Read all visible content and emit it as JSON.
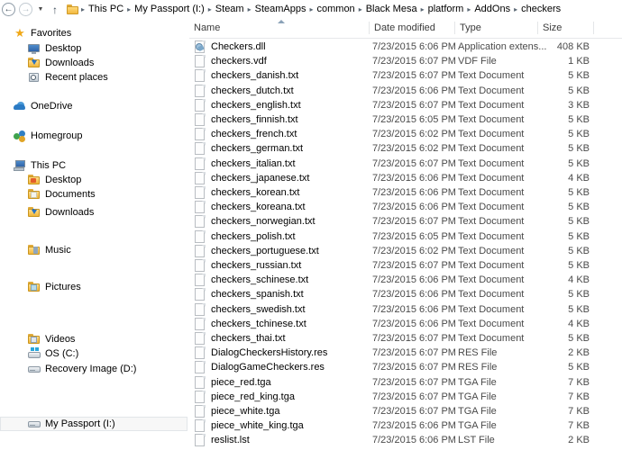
{
  "nav": {
    "back_label": "Back",
    "forward_label": "Forward",
    "recent_label": "Recent locations",
    "up_label": "Up one level",
    "breadcrumb": [
      "This PC",
      "My Passport (I:)",
      "Steam",
      "SteamApps",
      "common",
      "Black Mesa",
      "platform",
      "AddOns",
      "checkers"
    ],
    "separator": "▸"
  },
  "sidebar": {
    "groups": [
      {
        "name": "Favorites",
        "icon": "star-icon",
        "items": [
          {
            "label": "Desktop",
            "icon": "monitor-icon"
          },
          {
            "label": "Downloads",
            "icon": "downloads-folder-icon"
          },
          {
            "label": "Recent places",
            "icon": "recent-places-icon"
          }
        ]
      },
      {
        "name": "OneDrive",
        "icon": "cloud-icon",
        "items": []
      },
      {
        "name": "Homegroup",
        "icon": "homegroup-icon",
        "items": []
      },
      {
        "name": "This PC",
        "icon": "this-pc-icon",
        "items": [
          {
            "label": "Desktop",
            "icon": "desktop-folder-icon"
          },
          {
            "label": "Documents",
            "icon": "documents-folder-icon"
          },
          {
            "label": "Downloads",
            "icon": "downloads-folder-icon"
          },
          {
            "label": "Music",
            "icon": "music-folder-icon"
          },
          {
            "label": "Pictures",
            "icon": "pictures-folder-icon"
          },
          {
            "label": "Videos",
            "icon": "videos-folder-icon"
          },
          {
            "label": "OS (C:)",
            "icon": "os-drive-icon"
          },
          {
            "label": "Recovery Image (D:)",
            "icon": "drive-icon"
          }
        ]
      }
    ],
    "selected": {
      "label": "My Passport (I:)",
      "icon": "drive-icon"
    }
  },
  "columns": [
    {
      "key": "name",
      "label": "Name",
      "sorted": "asc"
    },
    {
      "key": "date",
      "label": "Date modified"
    },
    {
      "key": "type",
      "label": "Type"
    },
    {
      "key": "size",
      "label": "Size"
    }
  ],
  "files": [
    {
      "name": "Checkers.dll",
      "date": "7/23/2015 6:06 PM",
      "type": "Application extens...",
      "size": "408 KB",
      "icon": "dll-icon"
    },
    {
      "name": "checkers.vdf",
      "date": "7/23/2015 6:07 PM",
      "type": "VDF File",
      "size": "1 KB",
      "icon": "file-icon"
    },
    {
      "name": "checkers_danish.txt",
      "date": "7/23/2015 6:07 PM",
      "type": "Text Document",
      "size": "5 KB",
      "icon": "file-icon"
    },
    {
      "name": "checkers_dutch.txt",
      "date": "7/23/2015 6:06 PM",
      "type": "Text Document",
      "size": "5 KB",
      "icon": "file-icon"
    },
    {
      "name": "checkers_english.txt",
      "date": "7/23/2015 6:07 PM",
      "type": "Text Document",
      "size": "3 KB",
      "icon": "file-icon"
    },
    {
      "name": "checkers_finnish.txt",
      "date": "7/23/2015 6:05 PM",
      "type": "Text Document",
      "size": "5 KB",
      "icon": "file-icon"
    },
    {
      "name": "checkers_french.txt",
      "date": "7/23/2015 6:02 PM",
      "type": "Text Document",
      "size": "5 KB",
      "icon": "file-icon"
    },
    {
      "name": "checkers_german.txt",
      "date": "7/23/2015 6:02 PM",
      "type": "Text Document",
      "size": "5 KB",
      "icon": "file-icon"
    },
    {
      "name": "checkers_italian.txt",
      "date": "7/23/2015 6:07 PM",
      "type": "Text Document",
      "size": "5 KB",
      "icon": "file-icon"
    },
    {
      "name": "checkers_japanese.txt",
      "date": "7/23/2015 6:06 PM",
      "type": "Text Document",
      "size": "4 KB",
      "icon": "file-icon"
    },
    {
      "name": "checkers_korean.txt",
      "date": "7/23/2015 6:06 PM",
      "type": "Text Document",
      "size": "5 KB",
      "icon": "file-icon"
    },
    {
      "name": "checkers_koreana.txt",
      "date": "7/23/2015 6:06 PM",
      "type": "Text Document",
      "size": "5 KB",
      "icon": "file-icon"
    },
    {
      "name": "checkers_norwegian.txt",
      "date": "7/23/2015 6:07 PM",
      "type": "Text Document",
      "size": "5 KB",
      "icon": "file-icon"
    },
    {
      "name": "checkers_polish.txt",
      "date": "7/23/2015 6:05 PM",
      "type": "Text Document",
      "size": "5 KB",
      "icon": "file-icon"
    },
    {
      "name": "checkers_portuguese.txt",
      "date": "7/23/2015 6:02 PM",
      "type": "Text Document",
      "size": "5 KB",
      "icon": "file-icon"
    },
    {
      "name": "checkers_russian.txt",
      "date": "7/23/2015 6:07 PM",
      "type": "Text Document",
      "size": "5 KB",
      "icon": "file-icon"
    },
    {
      "name": "checkers_schinese.txt",
      "date": "7/23/2015 6:06 PM",
      "type": "Text Document",
      "size": "4 KB",
      "icon": "file-icon"
    },
    {
      "name": "checkers_spanish.txt",
      "date": "7/23/2015 6:06 PM",
      "type": "Text Document",
      "size": "5 KB",
      "icon": "file-icon"
    },
    {
      "name": "checkers_swedish.txt",
      "date": "7/23/2015 6:06 PM",
      "type": "Text Document",
      "size": "5 KB",
      "icon": "file-icon"
    },
    {
      "name": "checkers_tchinese.txt",
      "date": "7/23/2015 6:06 PM",
      "type": "Text Document",
      "size": "4 KB",
      "icon": "file-icon"
    },
    {
      "name": "checkers_thai.txt",
      "date": "7/23/2015 6:07 PM",
      "type": "Text Document",
      "size": "5 KB",
      "icon": "file-icon"
    },
    {
      "name": "DialogCheckersHistory.res",
      "date": "7/23/2015 6:07 PM",
      "type": "RES File",
      "size": "2 KB",
      "icon": "file-icon"
    },
    {
      "name": "DialogGameCheckers.res",
      "date": "7/23/2015 6:07 PM",
      "type": "RES File",
      "size": "5 KB",
      "icon": "file-icon"
    },
    {
      "name": "piece_red.tga",
      "date": "7/23/2015 6:07 PM",
      "type": "TGA File",
      "size": "7 KB",
      "icon": "file-icon"
    },
    {
      "name": "piece_red_king.tga",
      "date": "7/23/2015 6:07 PM",
      "type": "TGA File",
      "size": "7 KB",
      "icon": "file-icon"
    },
    {
      "name": "piece_white.tga",
      "date": "7/23/2015 6:07 PM",
      "type": "TGA File",
      "size": "7 KB",
      "icon": "file-icon"
    },
    {
      "name": "piece_white_king.tga",
      "date": "7/23/2015 6:06 PM",
      "type": "TGA File",
      "size": "7 KB",
      "icon": "file-icon"
    },
    {
      "name": "reslist.lst",
      "date": "7/23/2015 6:06 PM",
      "type": "LST File",
      "size": "2 KB",
      "icon": "file-icon"
    }
  ]
}
